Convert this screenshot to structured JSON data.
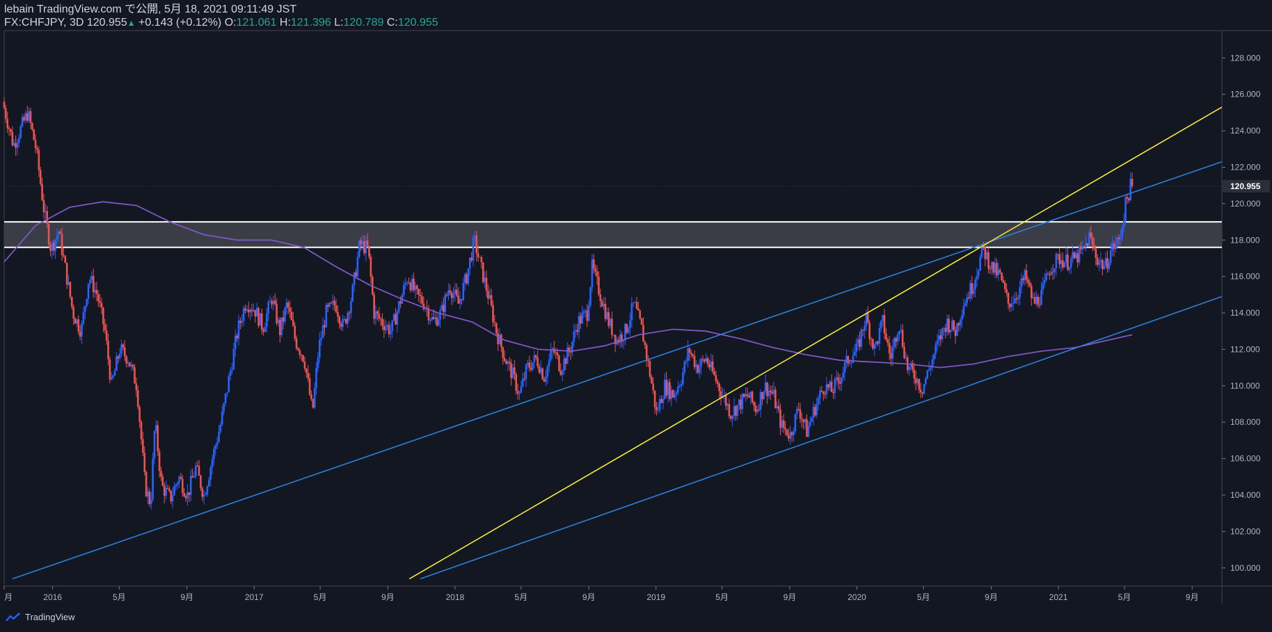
{
  "header": {
    "publisher": "lebain TradingView.com で公開, 5月 18, 2021 09:11:49 JST",
    "symbol": "FX:CHFJPY, 3D",
    "last": "120.955",
    "change_arrow": "▲",
    "change": "+0.143 (+0.12%)",
    "o_label": "O:",
    "o_value": "121.061",
    "h_label": "H:",
    "h_value": "121.396",
    "l_label": "L:",
    "l_value": "120.789",
    "c_label": "C:",
    "c_value": "120.955"
  },
  "footer": {
    "brand": "TradingView"
  },
  "colors": {
    "background": "#131722",
    "up": "#2962ff",
    "down": "#ef5350",
    "trendline": "#2f7ed8",
    "yellow_line": "#f5ea3d",
    "ma": "#7e57c2",
    "zone_fill": "#3a3d46",
    "zone_border": "#ffffff"
  },
  "chart_data": {
    "type": "candlestick",
    "symbol": "FX:CHFJPY",
    "interval": "3D",
    "last_price": 120.955,
    "ylim": [
      99,
      129.5
    ],
    "y_ticks": [
      "100.000",
      "102.000",
      "104.000",
      "106.000",
      "108.000",
      "110.000",
      "112.000",
      "114.000",
      "116.000",
      "118.000",
      "120.000",
      "122.000",
      "124.000",
      "126.000",
      "128.000"
    ],
    "x_range": [
      "2015-10-05",
      "2021-10-25"
    ],
    "x_ticks": [
      {
        "date": "2015-10-05",
        "label": "月"
      },
      {
        "date": "2016-01-01",
        "label": "2016"
      },
      {
        "date": "2016-05-01",
        "label": "5月"
      },
      {
        "date": "2016-09-01",
        "label": "9月"
      },
      {
        "date": "2017-01-01",
        "label": "2017"
      },
      {
        "date": "2017-05-01",
        "label": "5月"
      },
      {
        "date": "2017-09-01",
        "label": "9月"
      },
      {
        "date": "2018-01-01",
        "label": "2018"
      },
      {
        "date": "2018-05-01",
        "label": "5月"
      },
      {
        "date": "2018-09-01",
        "label": "9月"
      },
      {
        "date": "2019-01-01",
        "label": "2019"
      },
      {
        "date": "2019-05-01",
        "label": "5月"
      },
      {
        "date": "2019-09-01",
        "label": "9月"
      },
      {
        "date": "2020-01-01",
        "label": "2020"
      },
      {
        "date": "2020-05-01",
        "label": "5月"
      },
      {
        "date": "2020-09-01",
        "label": "9月"
      },
      {
        "date": "2021-01-01",
        "label": "2021"
      },
      {
        "date": "2021-05-01",
        "label": "5月"
      },
      {
        "date": "2021-09-01",
        "label": "9月"
      }
    ],
    "price_path": [
      [
        "2015-10-05",
        125.6
      ],
      [
        "2015-10-25",
        123.2
      ],
      [
        "2015-11-20",
        125.0
      ],
      [
        "2015-12-05",
        123.0
      ],
      [
        "2015-12-20",
        119.5
      ],
      [
        "2016-01-01",
        117.5
      ],
      [
        "2016-01-15",
        118.5
      ],
      [
        "2016-01-25",
        116.8
      ],
      [
        "2016-02-10",
        114.0
      ],
      [
        "2016-02-25",
        113.0
      ],
      [
        "2016-03-10",
        116.0
      ],
      [
        "2016-03-25",
        115.0
      ],
      [
        "2016-04-08",
        113.0
      ],
      [
        "2016-04-20",
        110.0
      ],
      [
        "2016-05-05",
        112.0
      ],
      [
        "2016-05-20",
        111.5
      ],
      [
        "2016-06-05",
        110.0
      ],
      [
        "2016-06-20",
        104.5
      ],
      [
        "2016-06-30",
        103.5
      ],
      [
        "2016-07-08",
        108.0
      ],
      [
        "2016-07-20",
        104.5
      ],
      [
        "2016-08-05",
        103.8
      ],
      [
        "2016-08-20",
        105.0
      ],
      [
        "2016-09-05",
        104.0
      ],
      [
        "2016-09-20",
        105.5
      ],
      [
        "2016-10-05",
        104.0
      ],
      [
        "2016-10-20",
        106.0
      ],
      [
        "2016-11-05",
        108.0
      ],
      [
        "2016-11-20",
        110.5
      ],
      [
        "2016-12-05",
        113.0
      ],
      [
        "2016-12-20",
        114.6
      ],
      [
        "2017-01-05",
        114.2
      ],
      [
        "2017-01-20",
        113.2
      ],
      [
        "2017-02-05",
        114.8
      ],
      [
        "2017-02-20",
        113.0
      ],
      [
        "2017-03-05",
        114.5
      ],
      [
        "2017-03-20",
        112.5
      ],
      [
        "2017-04-05",
        111.5
      ],
      [
        "2017-04-20",
        108.5
      ],
      [
        "2017-05-01",
        112.0
      ],
      [
        "2017-05-15",
        114.0
      ],
      [
        "2017-06-01",
        114.5
      ],
      [
        "2017-06-15",
        113.2
      ],
      [
        "2017-07-01",
        115.0
      ],
      [
        "2017-07-15",
        117.8
      ],
      [
        "2017-07-30",
        117.5
      ],
      [
        "2017-08-10",
        114.0
      ],
      [
        "2017-08-25",
        113.5
      ],
      [
        "2017-09-10",
        113.0
      ],
      [
        "2017-09-25",
        114.5
      ],
      [
        "2017-10-10",
        116.0
      ],
      [
        "2017-10-25",
        115.0
      ],
      [
        "2017-11-10",
        114.5
      ],
      [
        "2017-11-25",
        113.5
      ],
      [
        "2017-12-10",
        114.0
      ],
      [
        "2017-12-25",
        115.5
      ],
      [
        "2018-01-10",
        114.5
      ],
      [
        "2018-01-25",
        116.0
      ],
      [
        "2018-02-08",
        118.0
      ],
      [
        "2018-02-20",
        116.5
      ],
      [
        "2018-03-05",
        115.0
      ],
      [
        "2018-03-20",
        113.0
      ],
      [
        "2018-04-05",
        111.5
      ],
      [
        "2018-04-20",
        110.5
      ],
      [
        "2018-05-01",
        109.5
      ],
      [
        "2018-05-15",
        111.0
      ],
      [
        "2018-06-01",
        111.5
      ],
      [
        "2018-06-15",
        110.5
      ],
      [
        "2018-07-01",
        112.0
      ],
      [
        "2018-07-15",
        111.0
      ],
      [
        "2018-08-01",
        112.0
      ],
      [
        "2018-08-15",
        113.5
      ],
      [
        "2018-09-01",
        114.0
      ],
      [
        "2018-09-10",
        116.5
      ],
      [
        "2018-09-25",
        115.0
      ],
      [
        "2018-10-10",
        113.5
      ],
      [
        "2018-10-25",
        112.5
      ],
      [
        "2018-11-10",
        113.0
      ],
      [
        "2018-11-25",
        114.5
      ],
      [
        "2018-12-10",
        113.0
      ],
      [
        "2018-12-25",
        110.5
      ],
      [
        "2019-01-05",
        108.5
      ],
      [
        "2019-01-20",
        110.0
      ],
      [
        "2019-02-05",
        109.5
      ],
      [
        "2019-02-20",
        110.5
      ],
      [
        "2019-03-05",
        112.0
      ],
      [
        "2019-03-20",
        111.0
      ],
      [
        "2019-04-05",
        111.5
      ],
      [
        "2019-04-20",
        110.5
      ],
      [
        "2019-05-05",
        109.5
      ],
      [
        "2019-05-20",
        108.5
      ],
      [
        "2019-06-05",
        109.0
      ],
      [
        "2019-06-20",
        109.5
      ],
      [
        "2019-07-05",
        108.7
      ],
      [
        "2019-07-20",
        110.0
      ],
      [
        "2019-08-05",
        109.5
      ],
      [
        "2019-08-20",
        107.8
      ],
      [
        "2019-09-05",
        107.3
      ],
      [
        "2019-09-20",
        108.8
      ],
      [
        "2019-10-05",
        107.5
      ],
      [
        "2019-10-20",
        108.8
      ],
      [
        "2019-11-05",
        110.0
      ],
      [
        "2019-11-20",
        109.7
      ],
      [
        "2019-12-05",
        110.5
      ],
      [
        "2019-12-20",
        111.5
      ],
      [
        "2020-01-05",
        112.0
      ],
      [
        "2020-01-20",
        113.8
      ],
      [
        "2020-02-05",
        112.0
      ],
      [
        "2020-02-20",
        113.5
      ],
      [
        "2020-03-05",
        111.5
      ],
      [
        "2020-03-20",
        113.5
      ],
      [
        "2020-04-05",
        111.0
      ],
      [
        "2020-04-20",
        110.5
      ],
      [
        "2020-05-01",
        109.8
      ],
      [
        "2020-05-15",
        111.0
      ],
      [
        "2020-06-01",
        112.5
      ],
      [
        "2020-06-15",
        113.5
      ],
      [
        "2020-07-01",
        113.0
      ],
      [
        "2020-07-15",
        114.5
      ],
      [
        "2020-08-01",
        115.5
      ],
      [
        "2020-08-20",
        117.5
      ],
      [
        "2020-09-05",
        116.5
      ],
      [
        "2020-09-20",
        116.0
      ],
      [
        "2020-10-05",
        114.5
      ],
      [
        "2020-10-20",
        115.0
      ],
      [
        "2020-11-05",
        116.0
      ],
      [
        "2020-11-20",
        114.5
      ],
      [
        "2020-12-05",
        115.0
      ],
      [
        "2020-12-20",
        116.5
      ],
      [
        "2021-01-05",
        117.0
      ],
      [
        "2021-01-20",
        116.8
      ],
      [
        "2021-02-05",
        117.0
      ],
      [
        "2021-02-20",
        117.5
      ],
      [
        "2021-03-01",
        118.2
      ],
      [
        "2021-03-15",
        117.0
      ],
      [
        "2021-03-30",
        116.5
      ],
      [
        "2021-04-10",
        117.5
      ],
      [
        "2021-04-25",
        118.0
      ],
      [
        "2021-05-05",
        119.8
      ],
      [
        "2021-05-15",
        120.955
      ]
    ],
    "moving_average": [
      [
        "2015-10-05",
        116.8
      ],
      [
        "2015-12-01",
        118.8
      ],
      [
        "2016-02-01",
        119.8
      ],
      [
        "2016-04-01",
        120.1
      ],
      [
        "2016-06-01",
        119.9
      ],
      [
        "2016-08-01",
        119.0
      ],
      [
        "2016-10-01",
        118.3
      ],
      [
        "2016-12-01",
        118.0
      ],
      [
        "2017-02-01",
        118.0
      ],
      [
        "2017-04-01",
        117.6
      ],
      [
        "2017-06-01",
        116.5
      ],
      [
        "2017-08-01",
        115.5
      ],
      [
        "2017-10-01",
        114.7
      ],
      [
        "2017-12-01",
        114.0
      ],
      [
        "2018-02-01",
        113.5
      ],
      [
        "2018-04-01",
        112.5
      ],
      [
        "2018-06-01",
        112.0
      ],
      [
        "2018-08-01",
        111.9
      ],
      [
        "2018-10-01",
        112.2
      ],
      [
        "2018-12-01",
        112.8
      ],
      [
        "2019-02-01",
        113.1
      ],
      [
        "2019-04-01",
        113.0
      ],
      [
        "2019-06-01",
        112.6
      ],
      [
        "2019-08-01",
        112.1
      ],
      [
        "2019-10-01",
        111.7
      ],
      [
        "2019-12-01",
        111.4
      ],
      [
        "2020-02-01",
        111.3
      ],
      [
        "2020-04-01",
        111.2
      ],
      [
        "2020-06-01",
        111.0
      ],
      [
        "2020-08-01",
        111.2
      ],
      [
        "2020-10-01",
        111.6
      ],
      [
        "2020-12-01",
        111.9
      ],
      [
        "2021-02-01",
        112.1
      ],
      [
        "2021-05-15",
        112.8
      ]
    ],
    "resistance_zone": {
      "low": 117.6,
      "high": 119.0,
      "from": "2015-10-05",
      "to": "2021-10-25"
    },
    "trendlines": [
      {
        "color": "blue",
        "points": [
          [
            "2015-10-20",
            99.4
          ],
          [
            "2021-10-25",
            122.3
          ]
        ]
      },
      {
        "color": "yellow",
        "points": [
          [
            "2017-10-10",
            99.4
          ],
          [
            "2021-10-25",
            125.3
          ]
        ]
      },
      {
        "color": "blue",
        "points": [
          [
            "2017-10-30",
            99.4
          ],
          [
            "2021-10-25",
            114.9
          ]
        ]
      }
    ],
    "grid": false,
    "legend": "none"
  }
}
